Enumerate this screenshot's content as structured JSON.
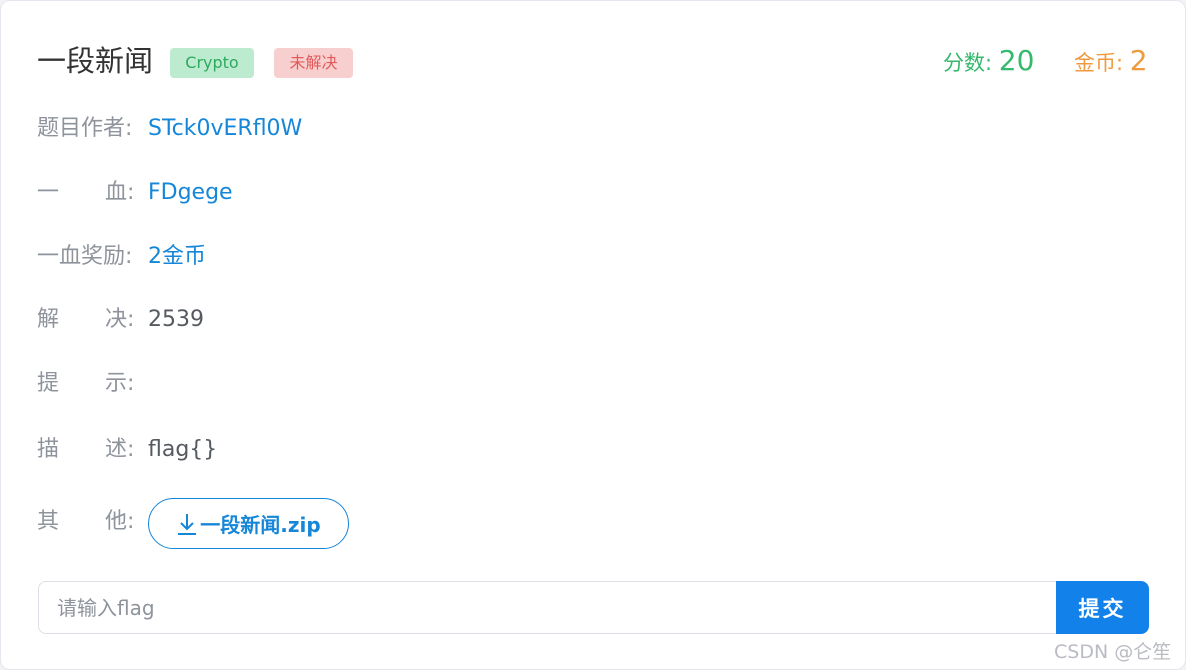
{
  "challenge": {
    "title": "一段新闻",
    "type_tag": "Crypto",
    "status_tag": "未解决",
    "score_label": "分数:",
    "score_value": "20",
    "coin_label": "金币:",
    "coin_value": "2"
  },
  "fields": {
    "author_label": "题目作者:",
    "author_value": "STck0vERfl0W",
    "first_blood_label_1": "一",
    "first_blood_label_2": "血:",
    "first_blood_value": "FDgege",
    "reward_label": "一血奖励:",
    "reward_value": "2金币",
    "solved_label_1": "解",
    "solved_label_2": "决:",
    "solved_value": "2539",
    "hint_label_1": "提",
    "hint_label_2": "示:",
    "hint_value": "",
    "desc_label_1": "描",
    "desc_label_2": "述:",
    "desc_value": "flag{}",
    "other_label_1": "其",
    "other_label_2": "他:",
    "attachment_name": "一段新闻.zip"
  },
  "flag_form": {
    "placeholder": "请输入flag",
    "value": "",
    "submit_label": "提交"
  },
  "watermark": "CSDN @仑笙",
  "colors": {
    "accent_blue": "#1686d8",
    "submit_blue": "#1282ea",
    "score_green": "#35b96c",
    "coin_orange": "#f09a3e",
    "tag_green_bg": "#bcebcf",
    "tag_red_bg": "#f8cfcf"
  },
  "icons": {
    "download": "download-icon"
  }
}
